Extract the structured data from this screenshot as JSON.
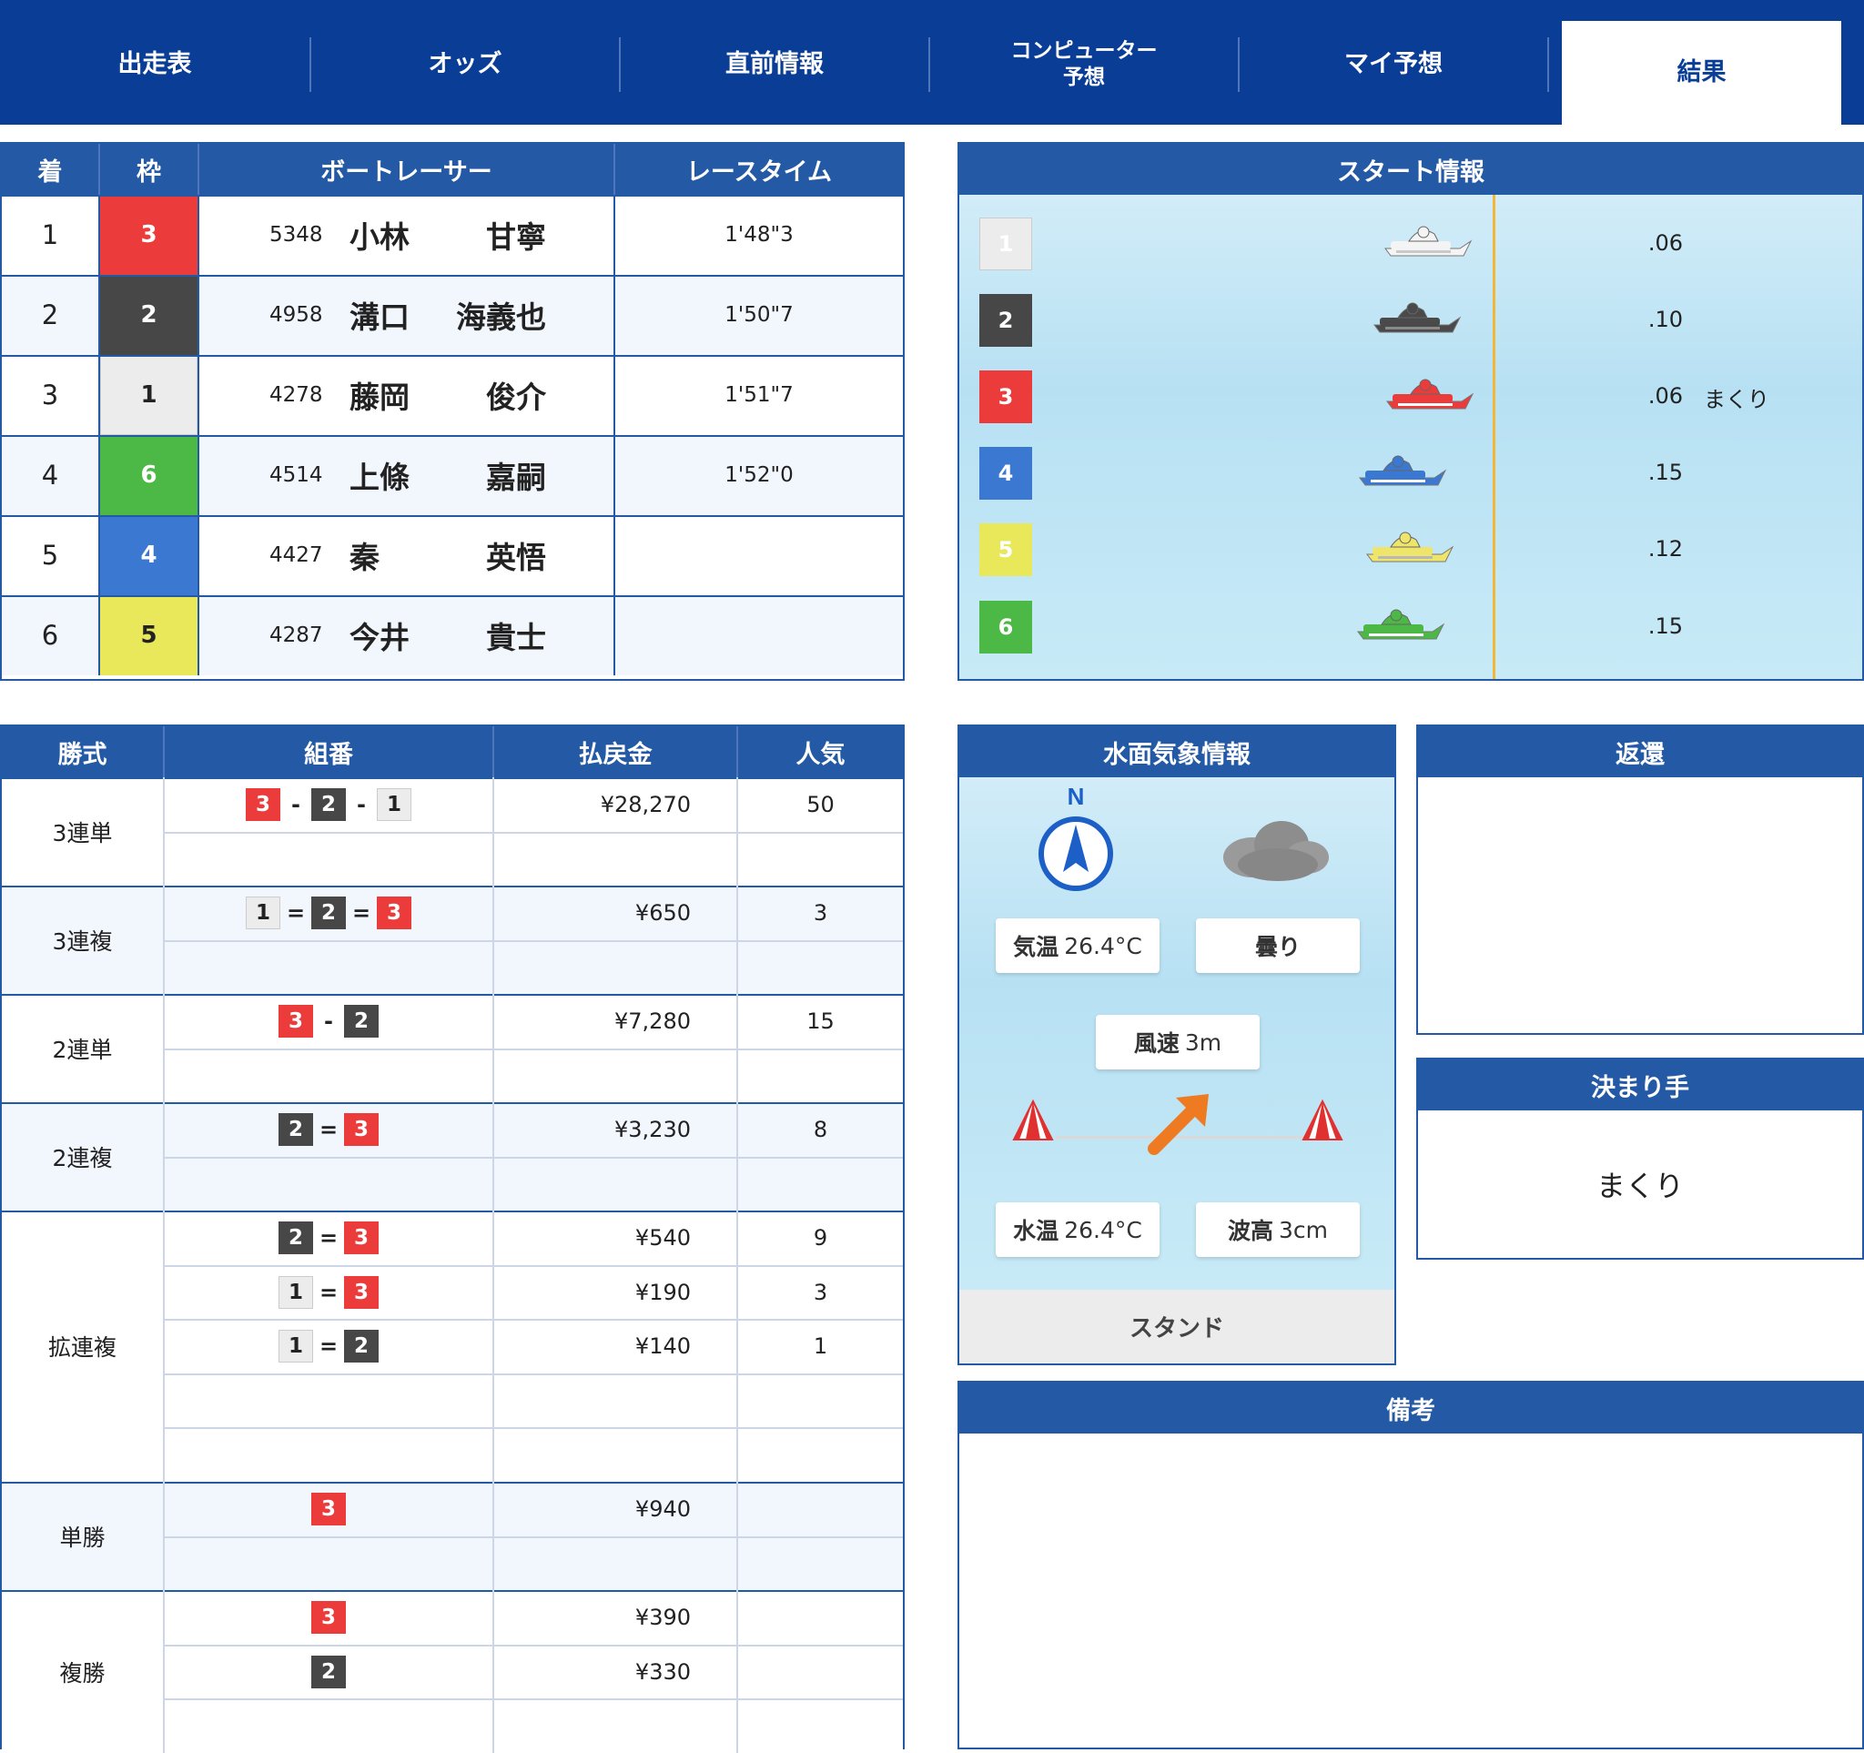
{
  "nav": {
    "tabs": [
      "出走表",
      "オッズ",
      "直前情報",
      "コンピューター\n予想",
      "マイ予想",
      "結果"
    ],
    "tab_computer_line1": "コンピューター",
    "tab_computer_line2": "予想"
  },
  "results": {
    "headers": [
      "着",
      "枠",
      "ボートレーサー",
      "レースタイム"
    ],
    "rows": [
      {
        "rank": "1",
        "waku": "3",
        "id": "5348",
        "sei": "小林",
        "mei": "甘寧",
        "time": "1'48\"3"
      },
      {
        "rank": "2",
        "waku": "2",
        "id": "4958",
        "sei": "溝口",
        "mei": "海義也",
        "time": "1'50\"7"
      },
      {
        "rank": "3",
        "waku": "1",
        "id": "4278",
        "sei": "藤岡",
        "mei": "俊介",
        "time": "1'51\"7"
      },
      {
        "rank": "4",
        "waku": "6",
        "id": "4514",
        "sei": "上條",
        "mei": "嘉嗣",
        "time": "1'52\"0"
      },
      {
        "rank": "5",
        "waku": "4",
        "id": "4427",
        "sei": "秦",
        "mei": "英悟",
        "time": ""
      },
      {
        "rank": "6",
        "waku": "5",
        "id": "4287",
        "sei": "今井",
        "mei": "貴士",
        "time": ""
      }
    ]
  },
  "start_info": {
    "title": "スタート情報",
    "lanes": [
      {
        "lane": "1",
        "st": ".06",
        "note": ""
      },
      {
        "lane": "2",
        "st": ".10",
        "note": ""
      },
      {
        "lane": "3",
        "st": ".06",
        "note": "まくり"
      },
      {
        "lane": "4",
        "st": ".15",
        "note": ""
      },
      {
        "lane": "5",
        "st": ".12",
        "note": ""
      },
      {
        "lane": "6",
        "st": ".15",
        "note": ""
      }
    ]
  },
  "payout": {
    "headers": [
      "勝式",
      "組番",
      "払戻金",
      "人気"
    ],
    "groups": [
      {
        "name": "3連単",
        "rows": [
          {
            "combo": [
              "3",
              "-",
              "2",
              "-",
              "1"
            ],
            "amount": "¥28,270",
            "pop": "50"
          }
        ]
      },
      {
        "name": "3連複",
        "rows": [
          {
            "combo": [
              "1",
              "=",
              "2",
              "=",
              "3"
            ],
            "amount": "¥650",
            "pop": "3"
          }
        ]
      },
      {
        "name": "2連単",
        "rows": [
          {
            "combo": [
              "3",
              "-",
              "2"
            ],
            "amount": "¥7,280",
            "pop": "15"
          }
        ]
      },
      {
        "name": "2連複",
        "rows": [
          {
            "combo": [
              "2",
              "=",
              "3"
            ],
            "amount": "¥3,230",
            "pop": "8"
          }
        ]
      },
      {
        "name": "拡連複",
        "rows": [
          {
            "combo": [
              "2",
              "=",
              "3"
            ],
            "amount": "¥540",
            "pop": "9"
          },
          {
            "combo": [
              "1",
              "=",
              "3"
            ],
            "amount": "¥190",
            "pop": "3"
          },
          {
            "combo": [
              "1",
              "=",
              "2"
            ],
            "amount": "¥140",
            "pop": "1"
          }
        ]
      },
      {
        "name": "単勝",
        "rows": [
          {
            "combo": [
              "3"
            ],
            "amount": "¥940",
            "pop": ""
          }
        ]
      },
      {
        "name": "複勝",
        "rows": [
          {
            "combo": [
              "3"
            ],
            "amount": "¥390",
            "pop": ""
          },
          {
            "combo": [
              "2"
            ],
            "amount": "¥330",
            "pop": ""
          }
        ]
      }
    ]
  },
  "weather": {
    "title": "水面気象情報",
    "compass": "N",
    "air_label": "気温",
    "air_value": "26.4°C",
    "sky": "曇り",
    "wind_label": "風速",
    "wind_value": "3m",
    "water_label": "水温",
    "water_value": "26.4°C",
    "wave_label": "波高",
    "wave_value": "3cm",
    "stand": "スタンド"
  },
  "refund": {
    "title": "返還"
  },
  "kimarite": {
    "title": "決まり手",
    "value": "まくり"
  },
  "remarks": {
    "title": "備考"
  },
  "colors": {
    "nav": "#0a3e96",
    "header": "#2359a5",
    "lane1": "#ececec",
    "lane2": "#474747",
    "lane3": "#ec3b3b",
    "lane4": "#3b78d1",
    "lane5": "#e8e85a",
    "lane6": "#4cb846"
  }
}
